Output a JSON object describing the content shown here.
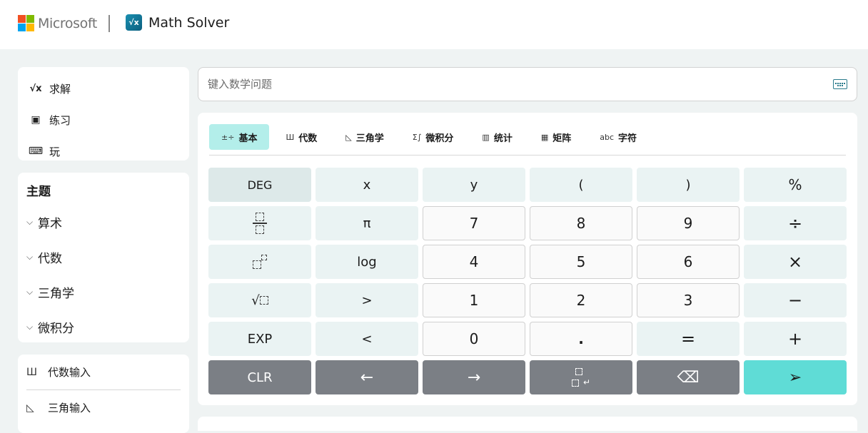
{
  "header": {
    "brand": "Microsoft",
    "app_icon": "√x",
    "app_title": "Math Solver",
    "logo_colors": [
      "#f25022",
      "#7fba00",
      "#00a4ef",
      "#ffb900"
    ]
  },
  "nav": {
    "items": [
      {
        "label": "求解",
        "icon": "sqrt-x-icon",
        "glyph": "√x"
      },
      {
        "label": "练习",
        "icon": "practice-icon",
        "glyph": "▣"
      },
      {
        "label": "玩",
        "icon": "gamepad-icon",
        "glyph": "⌨"
      }
    ]
  },
  "topics": {
    "title": "主题",
    "items": [
      "算术",
      "代数",
      "三角学",
      "微积分"
    ]
  },
  "inputs": {
    "items": [
      {
        "label": "代数输入",
        "icon": "algebra-icon",
        "glyph": "Ш"
      },
      {
        "label": "三角输入",
        "icon": "triangle-icon",
        "glyph": "◺"
      }
    ]
  },
  "search": {
    "placeholder": "键入数学问题",
    "value": ""
  },
  "tabs": [
    {
      "label": "基本",
      "glyph": "±÷",
      "active": true
    },
    {
      "label": "代数",
      "glyph": "Ш",
      "active": false
    },
    {
      "label": "三角学",
      "glyph": "◺",
      "active": false
    },
    {
      "label": "微积分",
      "glyph": "Σ∫",
      "active": false
    },
    {
      "label": "统计",
      "glyph": "▥",
      "active": false
    },
    {
      "label": "矩阵",
      "glyph": "▦",
      "active": false
    },
    {
      "label": "字符",
      "glyph": "abc",
      "active": false
    }
  ],
  "keys": {
    "deg": "DEG",
    "x": "x",
    "y": "y",
    "lparen": "(",
    "rparen": ")",
    "percent": "%",
    "pi": "π",
    "seven": "7",
    "eight": "8",
    "nine": "9",
    "divide": "÷",
    "log": "log",
    "four": "4",
    "five": "5",
    "six": "6",
    "multiply": "×",
    "sqrt": "√",
    "gt": ">",
    "one": "1",
    "two": "2",
    "three": "3",
    "minus": "−",
    "exp": "EXP",
    "lt": "<",
    "zero": "0",
    "dot": ".",
    "equals": "=",
    "plus": "+",
    "clr": "CLR",
    "left": "←",
    "right": "→",
    "enter": "↵",
    "backspace": "⌫",
    "send": "➢"
  },
  "colors": {
    "active_tab": "#b3eeea",
    "function_key": "#eaf3f3",
    "control_key": "#7b7f85",
    "send_key": "#5fdcd6",
    "page_bg": "#eff3f3"
  }
}
